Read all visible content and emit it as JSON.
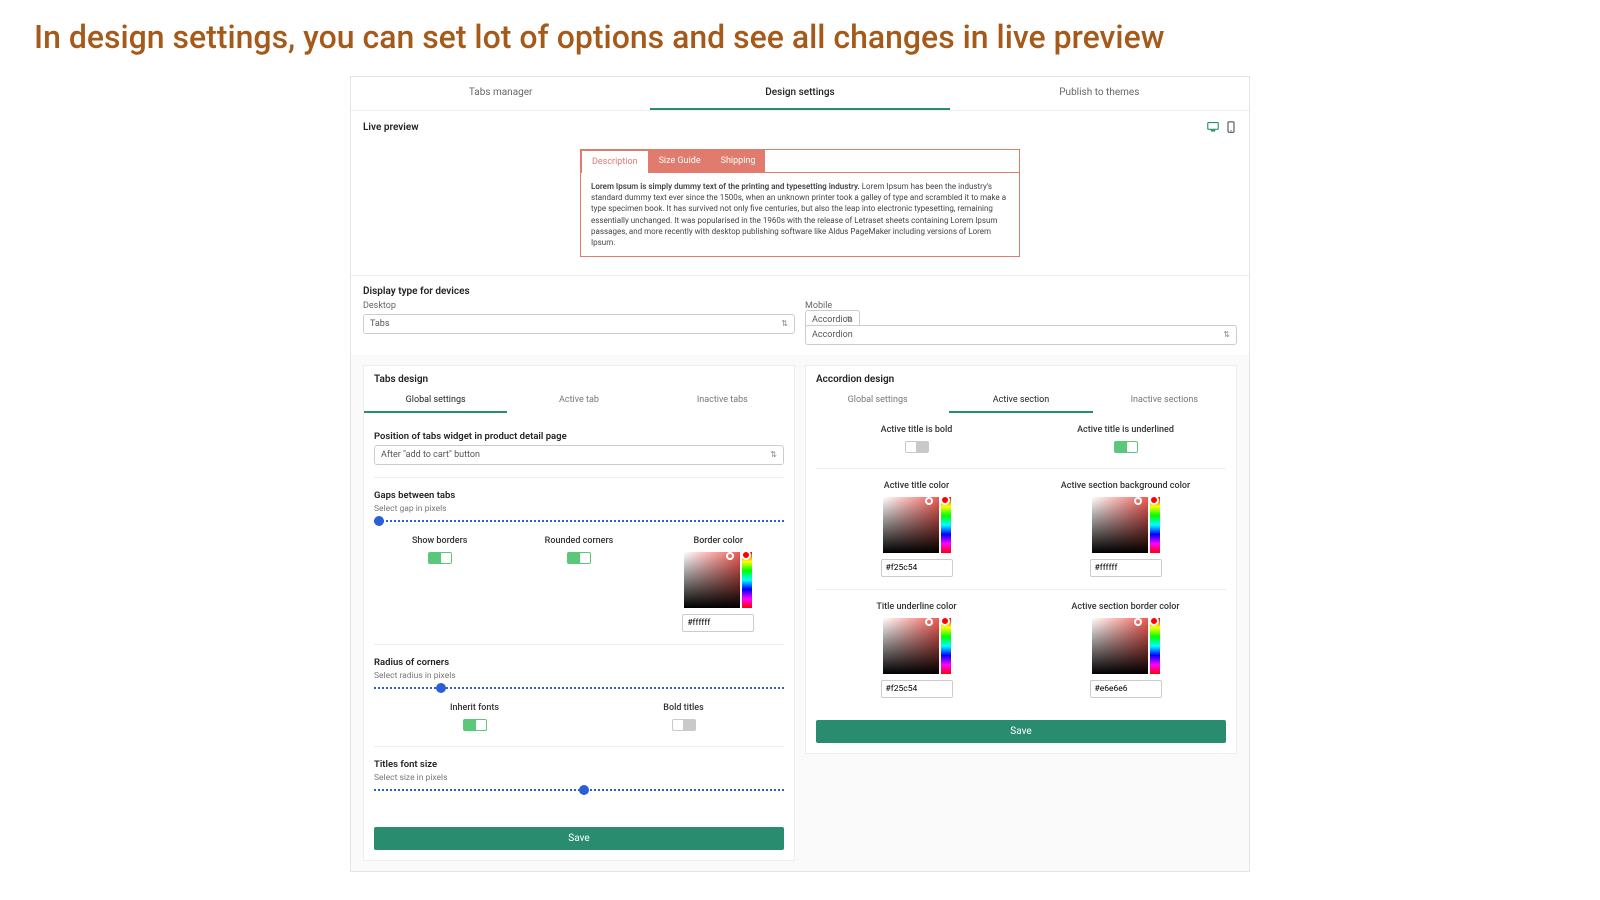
{
  "headline": "In design settings, you can set lot of options and see all changes in live preview",
  "topnav": {
    "items": [
      "Tabs manager",
      "Design settings",
      "Publish to themes"
    ],
    "active": 1
  },
  "preview": {
    "label": "Live preview",
    "tabs": [
      "Description",
      "Size Guide",
      "Shipping"
    ],
    "active_tab": 0,
    "body_bold": "Lorem Ipsum is simply dummy text of the printing and typesetting industry.",
    "body_rest": " Lorem Ipsum has been the industry's standard dummy text ever since the 1500s, when an unknown printer took a galley of type and scrambled it to make a type specimen book. It has survived not only five centuries, but also the leap into electronic typesetting, remaining essentially unchanged. It was popularised in the 1960s with the release of Letraset sheets containing Lorem Ipsum passages, and more recently with desktop publishing software like Aldus PageMaker including versions of Lorem Ipsum."
  },
  "display_type": {
    "heading": "Display type for devices",
    "desktop_label": "Desktop",
    "desktop_value": "Tabs",
    "mobile_label": "Mobile",
    "mobile_value": "Accordion"
  },
  "tabs_design": {
    "heading": "Tabs design",
    "subtabs": [
      "Global settings",
      "Active tab",
      "Inactive tabs"
    ],
    "active_subtab": 0,
    "position_label": "Position of tabs widget in product detail page",
    "position_value": "After \"add to cart\" button",
    "gaps_heading": "Gaps between tabs",
    "gaps_label": "Select gap in pixels",
    "gaps_value_pct": 0,
    "show_borders_label": "Show borders",
    "show_borders": true,
    "rounded_label": "Rounded corners",
    "rounded": true,
    "border_color_label": "Border color",
    "border_color": "#ffffff",
    "radius_heading": "Radius of corners",
    "radius_label": "Select radius in pixels",
    "radius_value_pct": 15,
    "inherit_fonts_label": "Inherit fonts",
    "inherit_fonts": true,
    "bold_titles_label": "Bold titles",
    "bold_titles": false,
    "font_size_heading": "Titles font size",
    "font_size_label": "Select size in pixels",
    "font_size_value_pct": 50,
    "save": "Save"
  },
  "accordion_design": {
    "heading": "Accordion design",
    "subtabs": [
      "Global settings",
      "Active section",
      "Inactive sections"
    ],
    "active_subtab": 1,
    "active_title_bold_label": "Active title is bold",
    "active_title_bold": false,
    "active_title_underlined_label": "Active title is underlined",
    "active_title_underlined": true,
    "active_title_color_label": "Active title color",
    "active_title_color": "#f25c54",
    "active_bg_label": "Active section background color",
    "active_bg": "#ffffff",
    "underline_color_label": "Title underline color",
    "underline_color": "#f25c54",
    "border_color_label": "Active section border color",
    "border_color": "#e6e6e6",
    "save": "Save"
  }
}
